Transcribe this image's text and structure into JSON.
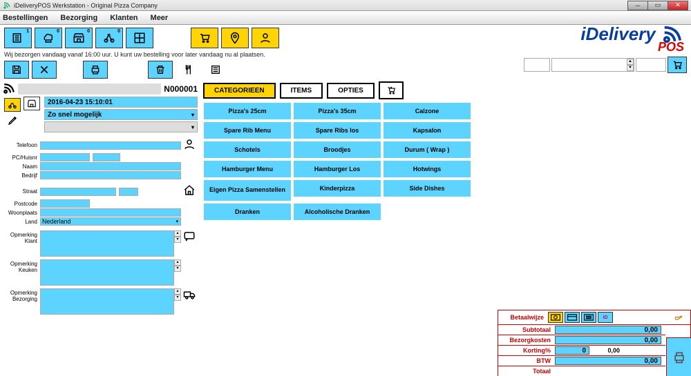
{
  "window": {
    "title": "iDeliveryPOS Werkstation - Original Pizza Company"
  },
  "menu": [
    "Bestellingen",
    "Bezorging",
    "Klanten",
    "Meer"
  ],
  "notice": "Wij bezorgen vandaag vanaf 16:00 uur. U kunt uw bestelling voor later vandaag nu al plaatsen.",
  "order": {
    "number": "N000001",
    "datetime": "2016-04-23 15:10:01",
    "delivery_mode": "Zo snel mogelijk"
  },
  "fields": {
    "telefoon": "Telefoon",
    "pchuisnr": "PC/Huisnr",
    "naam": "Naam",
    "bedrijf": "Bedrijf",
    "straat": "Straat",
    "postcode": "Postcode",
    "woonplaats": "Woonplaats",
    "land": "Land",
    "land_value": "Nederland",
    "opm_klant": "Opmerking Klant",
    "opm_keuken": "Opmerking Keuken",
    "opm_bezorg": "Opmerking Bezorging"
  },
  "tabs": {
    "cat": "CATEGORIEEN",
    "items": "ITEMS",
    "opties": "OPTIES"
  },
  "categories": [
    "Pizza's 25cm",
    "Pizza's 35cm",
    "Calzone",
    "Spare Rib Menu",
    "Spare Ribs los",
    "Kapsalon",
    "Schotels",
    "Broodjes",
    "Durum ( Wrap )",
    "Hamburger Menu",
    "Hamburger Los",
    "Hotwings",
    "Eigen Pizza Samenstellen",
    "Kinderpizza",
    "Side Dishes",
    "Dranken",
    "Alcoholische Dranken"
  ],
  "totals": {
    "betaalwijze": "Betaalwijze",
    "subtotaal": "Subtotaal",
    "bezorg": "Bezorgkosten",
    "korting": "Korting%",
    "btw": "BTW",
    "totaal": "Totaal",
    "v_sub": "0,00",
    "v_bez": "0,00",
    "v_kort": "0",
    "v_kort2": "0,00",
    "v_btw": "0,00"
  },
  "logo": {
    "line1": "iDelivery",
    "line2": "POS"
  }
}
